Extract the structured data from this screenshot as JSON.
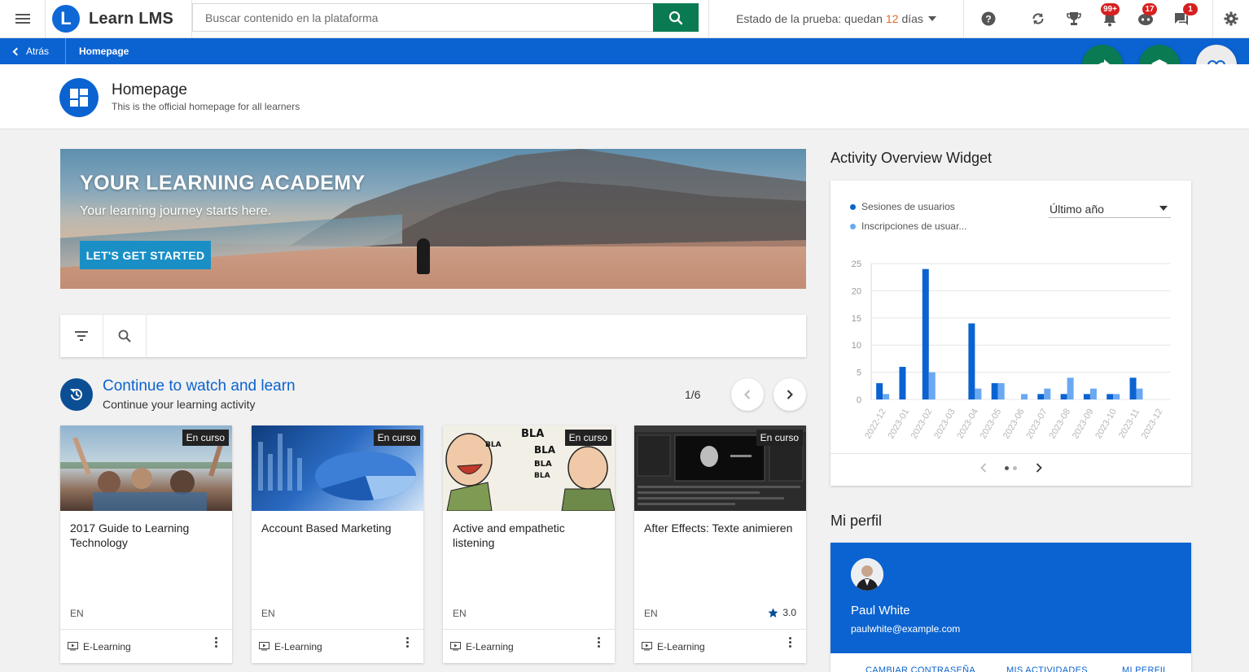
{
  "app": {
    "logo_letter": "L",
    "name": "Learn LMS"
  },
  "search": {
    "placeholder": "Buscar contenido en la plataforma"
  },
  "trial": {
    "label": "Estado de la prueba: quedan",
    "days": "12",
    "suffix": "días"
  },
  "toolbar": {
    "icons": [
      "help-icon",
      "sync-icon",
      "trophy-icon",
      "notifications-icon",
      "chat-bot-icon",
      "messages-icon",
      "settings-icon"
    ],
    "badges": {
      "notifications": "99+",
      "chat": "17",
      "messages": "1"
    }
  },
  "breadcrumb": {
    "back_label": "Atrás",
    "current": "Homepage"
  },
  "page": {
    "title": "Homepage",
    "subtitle": "This is the official homepage for all learners"
  },
  "hero": {
    "title": "YOUR LEARNING ACADEMY",
    "subtitle": "Your learning journey starts here.",
    "cta": "LET'S GET STARTED"
  },
  "continue": {
    "title": "Continue to watch and learn",
    "subtitle": "Continue your learning activity",
    "pager": "1/6",
    "cards": [
      {
        "title": "2017 Guide to Learning Technology",
        "status": "En curso",
        "lang": "EN",
        "type": "E-Learning",
        "rating": ""
      },
      {
        "title": "Account Based Marketing",
        "status": "En curso",
        "lang": "EN",
        "type": "E-Learning",
        "rating": ""
      },
      {
        "title": "Active and empathetic listening",
        "status": "En curso",
        "lang": "EN",
        "type": "E-Learning",
        "rating": ""
      },
      {
        "title": "After Effects: Texte animieren",
        "status": "En curso",
        "lang": "EN",
        "type": "E-Learning",
        "rating": "3.0"
      }
    ]
  },
  "activity_widget": {
    "title": "Activity Overview Widget",
    "period": "Último año",
    "legend": [
      "Sesiones de usuarios",
      "Inscripciones de usuar..."
    ]
  },
  "chart_data": {
    "type": "bar",
    "categories": [
      "2022-12",
      "2023-01",
      "2023-02",
      "2023-03",
      "2023-04",
      "2023-05",
      "2023-06",
      "2023-07",
      "2023-08",
      "2023-09",
      "2023-10",
      "2023-11",
      "2023-12"
    ],
    "series": [
      {
        "name": "Sesiones de usuarios",
        "color": "#0b63d1",
        "values": [
          3,
          6,
          24,
          0,
          14,
          3,
          0,
          1,
          1,
          1,
          1,
          4,
          0
        ]
      },
      {
        "name": "Inscripciones de usuar...",
        "color": "#6aa9f2",
        "values": [
          1,
          0,
          5,
          0,
          2,
          3,
          1,
          2,
          4,
          2,
          1,
          2,
          0
        ]
      }
    ],
    "yticks": [
      0,
      5,
      10,
      15,
      20,
      25
    ],
    "ylim": [
      0,
      25
    ],
    "grid": true
  },
  "profile": {
    "section_title": "Mi perfil",
    "name": "Paul White",
    "email": "paulwhite@example.com",
    "links": [
      "CAMBIAR CONTRASEÑA",
      "MIS ACTIVIDADES",
      "MI PERFIL"
    ]
  },
  "colors": {
    "brand_blue": "#0b63d1",
    "accent_green": "#0a7a52",
    "badge_red": "#d62020"
  }
}
